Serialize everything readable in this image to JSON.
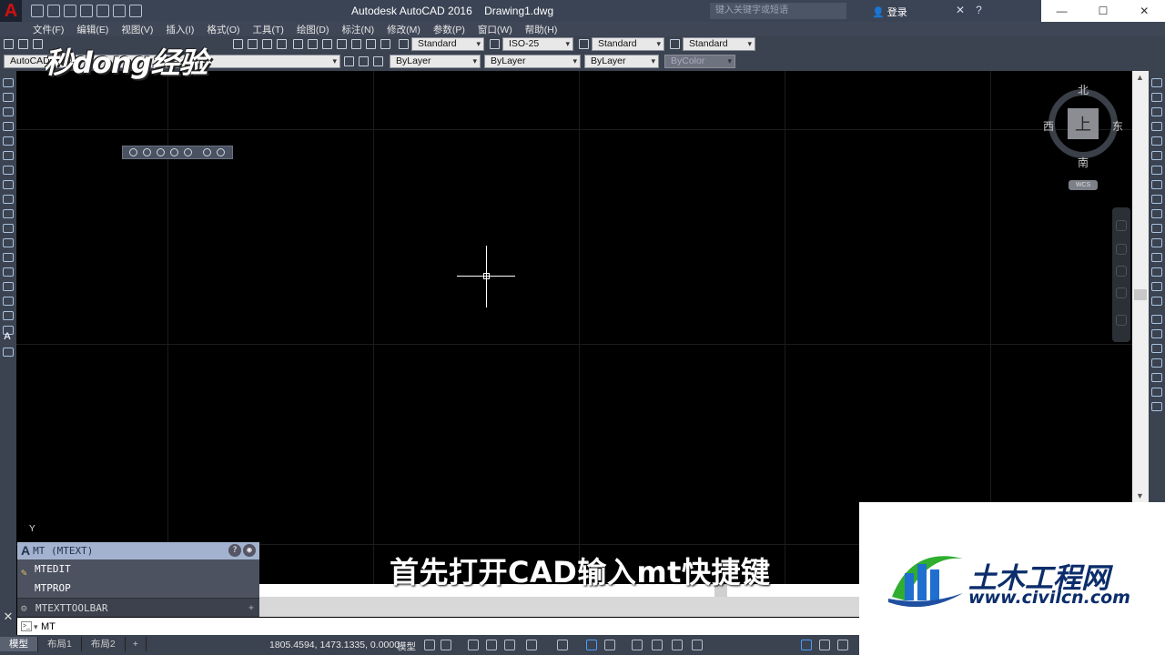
{
  "titlebar": {
    "app_title": "Autodesk AutoCAD 2016",
    "document": "Drawing1.dwg",
    "search_placeholder": "键入关键字或短语",
    "login_label": "登录",
    "help_label": "?"
  },
  "menu": [
    "文件(F)",
    "编辑(E)",
    "视图(V)",
    "插入(I)",
    "格式(O)",
    "工具(T)",
    "绘图(D)",
    "标注(N)",
    "修改(M)",
    "参数(P)",
    "窗口(W)",
    "帮助(H)"
  ],
  "toolbar1": {
    "text_style": "Standard",
    "dim_style": "ISO-25",
    "table_style": "Standard",
    "mleader_style": "Standard"
  },
  "toolbar2": {
    "workspace": "AutoCAD",
    "color": "ByLayer",
    "linetype": "ByLayer",
    "lineweight": "ByLayer",
    "plotstyle": "ByColor"
  },
  "viewcube": {
    "north": "北",
    "south": "南",
    "west": "西",
    "east": "东",
    "face": "上",
    "ucs": "WCS"
  },
  "canvas": {
    "ucs_y_label": "Y"
  },
  "autocomplete": {
    "header": "MT (MTEXT)",
    "items": [
      "MTEDIT",
      "MTPROP",
      "MTEXTTOOLBAR"
    ]
  },
  "commandline": {
    "input": "MT"
  },
  "statusbar": {
    "tabs": [
      "模型",
      "布局1",
      "布局2",
      "+"
    ],
    "coords": "1805.4594, 1473.1335, 0.0000",
    "model_label": "模型"
  },
  "caption": "首先打开CAD输入mt快捷键",
  "watermark_tl": "秒dong经验",
  "watermark_br": {
    "name": "土木工程网",
    "url": "www.civilcn.com"
  },
  "colors": {
    "accent_blue": "#0b2d6b",
    "autocomplete_header": "#a3b3cf"
  }
}
